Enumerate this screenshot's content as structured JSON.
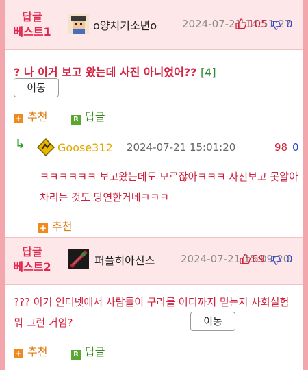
{
  "best1": {
    "label": "답글\n베스트1",
    "nick": "o양치기소년o",
    "date": "2024-07-21 14:51:27",
    "up": "105",
    "down": "0",
    "title": "? 나 이거 보고 왔는데 사진 아니었어??",
    "count": "[4]",
    "move": "이동",
    "recommend": "추천",
    "reply": "답글"
  },
  "comment": {
    "nick": "Goose312",
    "date": "2024-07-21 15:01:20",
    "up": "98",
    "down": "0",
    "text": "ㅋㅋㅋㅋㅋㅋ 보고왔는데도 모르잖아ㅋㅋㅋ 사진보고 못알아차리는 것도 당연한거네ㅋㅋㅋ",
    "recommend": "추천"
  },
  "best2": {
    "label": "답글\n베스트2",
    "nick": "퍼플히아신스",
    "date": "2024-07-21 15:09:20",
    "up": "69",
    "down": "0",
    "text": "??? 이거 인터넷에서 사람들이 구라를 어디까지 믿는지 사회실험 뭐 그런 거임?",
    "move": "이동",
    "recommend": "추천",
    "reply": "답글"
  },
  "icons": {
    "thumb_up": "thumb-up-icon",
    "thumb_down": "thumb-down-icon",
    "plus": "plus-icon",
    "reply_badge": "r-badge-icon",
    "reply_arrow": "reply-arrow-icon"
  },
  "colors": {
    "accent_red": "#d62240",
    "best_label": "#e0284f",
    "band_bg": "#fde7e9",
    "frame": "#f4a6ad",
    "recommend": "#e07a12",
    "reply": "#3a8a1a",
    "down": "#2e46c8"
  }
}
